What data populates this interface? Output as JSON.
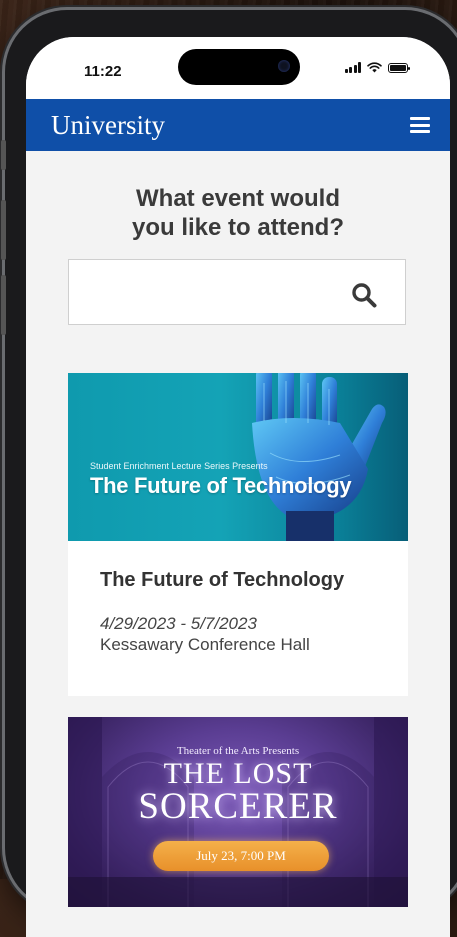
{
  "status_bar": {
    "time": "11:22",
    "battery_level": 1.0
  },
  "header": {
    "brand": "University",
    "menu_icon": "hamburger-menu-icon"
  },
  "main": {
    "heading_line1": "What event would",
    "heading_line2": "you like to attend?",
    "search": {
      "value": "",
      "placeholder": "",
      "icon": "search-icon"
    }
  },
  "events": [
    {
      "banner_supertitle": "Student Enrichment Lecture Series Presents",
      "banner_title": "The Future of Technology",
      "title": "The Future of Technology",
      "dates": "4/29/2023 - 5/7/2023",
      "venue": "Kessawary Conference Hall"
    },
    {
      "banner_supertitle": "Theater of the Arts Presents",
      "banner_title_line1": "THE LOST",
      "banner_title_line2": "SORCERER",
      "banner_date": "July 23, 7:00 PM"
    }
  ],
  "colors": {
    "brand_blue": "#0f4fa8",
    "page_bg": "#f3f3f3",
    "card_bg": "#ffffff"
  }
}
